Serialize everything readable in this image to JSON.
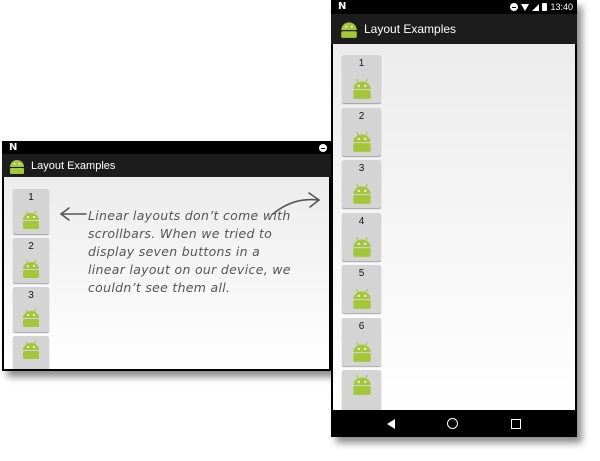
{
  "landscape": {
    "status": {
      "notification": "N"
    },
    "appbar": {
      "title": "Layout Examples",
      "icon": "android-icon"
    },
    "buttons": [
      "1",
      "2",
      "3",
      ""
    ]
  },
  "portrait": {
    "status": {
      "notification": "N",
      "time": "13:40"
    },
    "appbar": {
      "title": "Layout Examples",
      "icon": "android-icon"
    },
    "buttons": [
      "1",
      "2",
      "3",
      "4",
      "5",
      "6",
      ""
    ],
    "navbar": [
      "back-icon",
      "home-icon",
      "recents-icon"
    ]
  },
  "annotation": {
    "text": "Linear layouts don’t come with scrollbars. When we tried to display seven buttons in a linear layout on our device, we couldn’t see them all."
  },
  "colors": {
    "android_green": "#a4c639",
    "appbar": "#1c1c1c",
    "button": "#d4d4d4"
  }
}
